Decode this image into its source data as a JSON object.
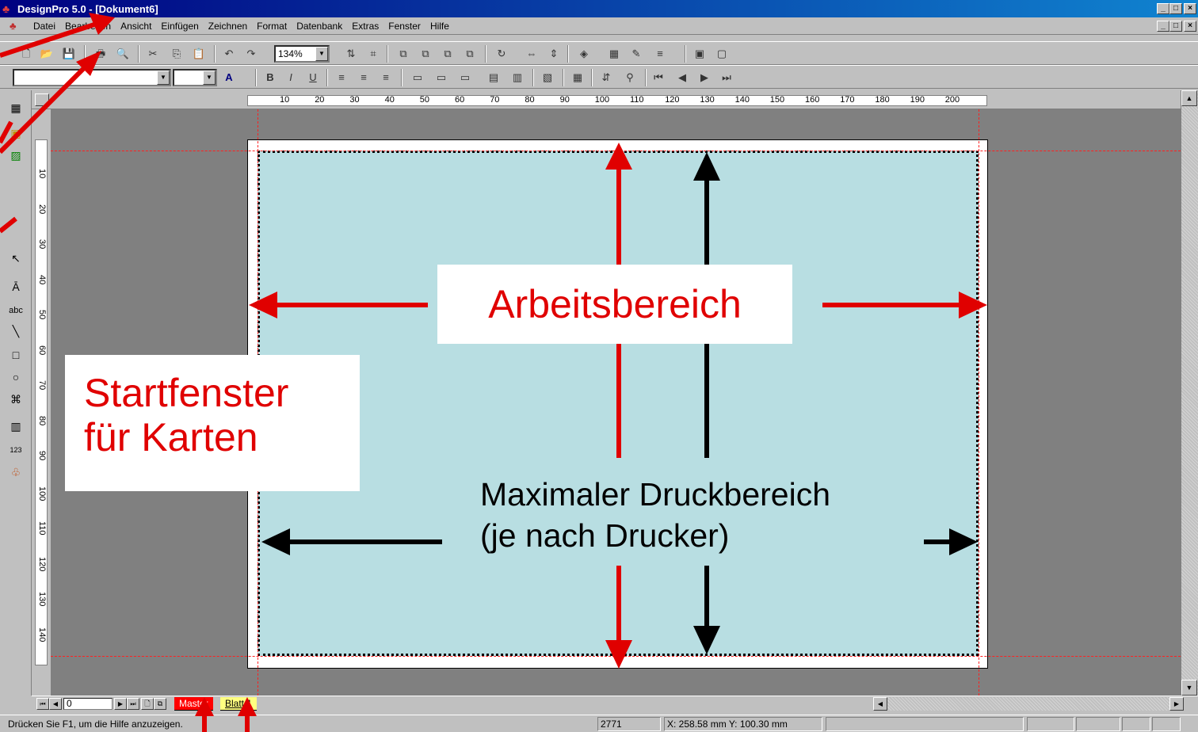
{
  "window": {
    "title": "DesignPro 5.0 - [Dokument6]",
    "controls": [
      "_",
      "□",
      "×"
    ]
  },
  "menu": {
    "items": [
      {
        "label": "Datei"
      },
      {
        "label": "Bearbeiten"
      },
      {
        "label": "Ansicht"
      },
      {
        "label": "Einfügen"
      },
      {
        "label": "Zeichnen"
      },
      {
        "label": "Format"
      },
      {
        "label": "Datenbank"
      },
      {
        "label": "Extras"
      },
      {
        "label": "Fenster"
      },
      {
        "label": "Hilfe"
      }
    ]
  },
  "toolbar": {
    "zoom": "134%",
    "font_combo": "",
    "size_combo": ""
  },
  "ruler": {
    "h_labels": [
      "10",
      "20",
      "30",
      "40",
      "50",
      "60",
      "70",
      "80",
      "90",
      "100",
      "110",
      "120",
      "130",
      "140",
      "150",
      "160",
      "170",
      "180",
      "190",
      "200"
    ],
    "v_labels": [
      "10",
      "20",
      "30",
      "40",
      "50",
      "60",
      "70",
      "80",
      "90",
      "100",
      "110",
      "120",
      "130",
      "140"
    ]
  },
  "annotations": {
    "work_area": "Arbeitsbereich",
    "start_window_line1": "Startfenster",
    "start_window_line2": "für Karten",
    "print_area_line1": "Maximaler Druckbereich",
    "print_area_line2": "(je nach Drucker)",
    "red": "#e00000",
    "black": "#000000"
  },
  "bottom": {
    "page_number": "0",
    "tabs": [
      {
        "label": "Master",
        "active": true
      },
      {
        "label": "Blatt 1",
        "active": false
      }
    ]
  },
  "status": {
    "help_text": "Drücken Sie F1, um die Hilfe anzuzeigen.",
    "count": "2771",
    "coords": "X: 258.58 mm  Y: 100.30 mm"
  },
  "colors": {
    "title_bar": "#000080",
    "print_area": "#b8dee2",
    "canvas": "#808080"
  }
}
